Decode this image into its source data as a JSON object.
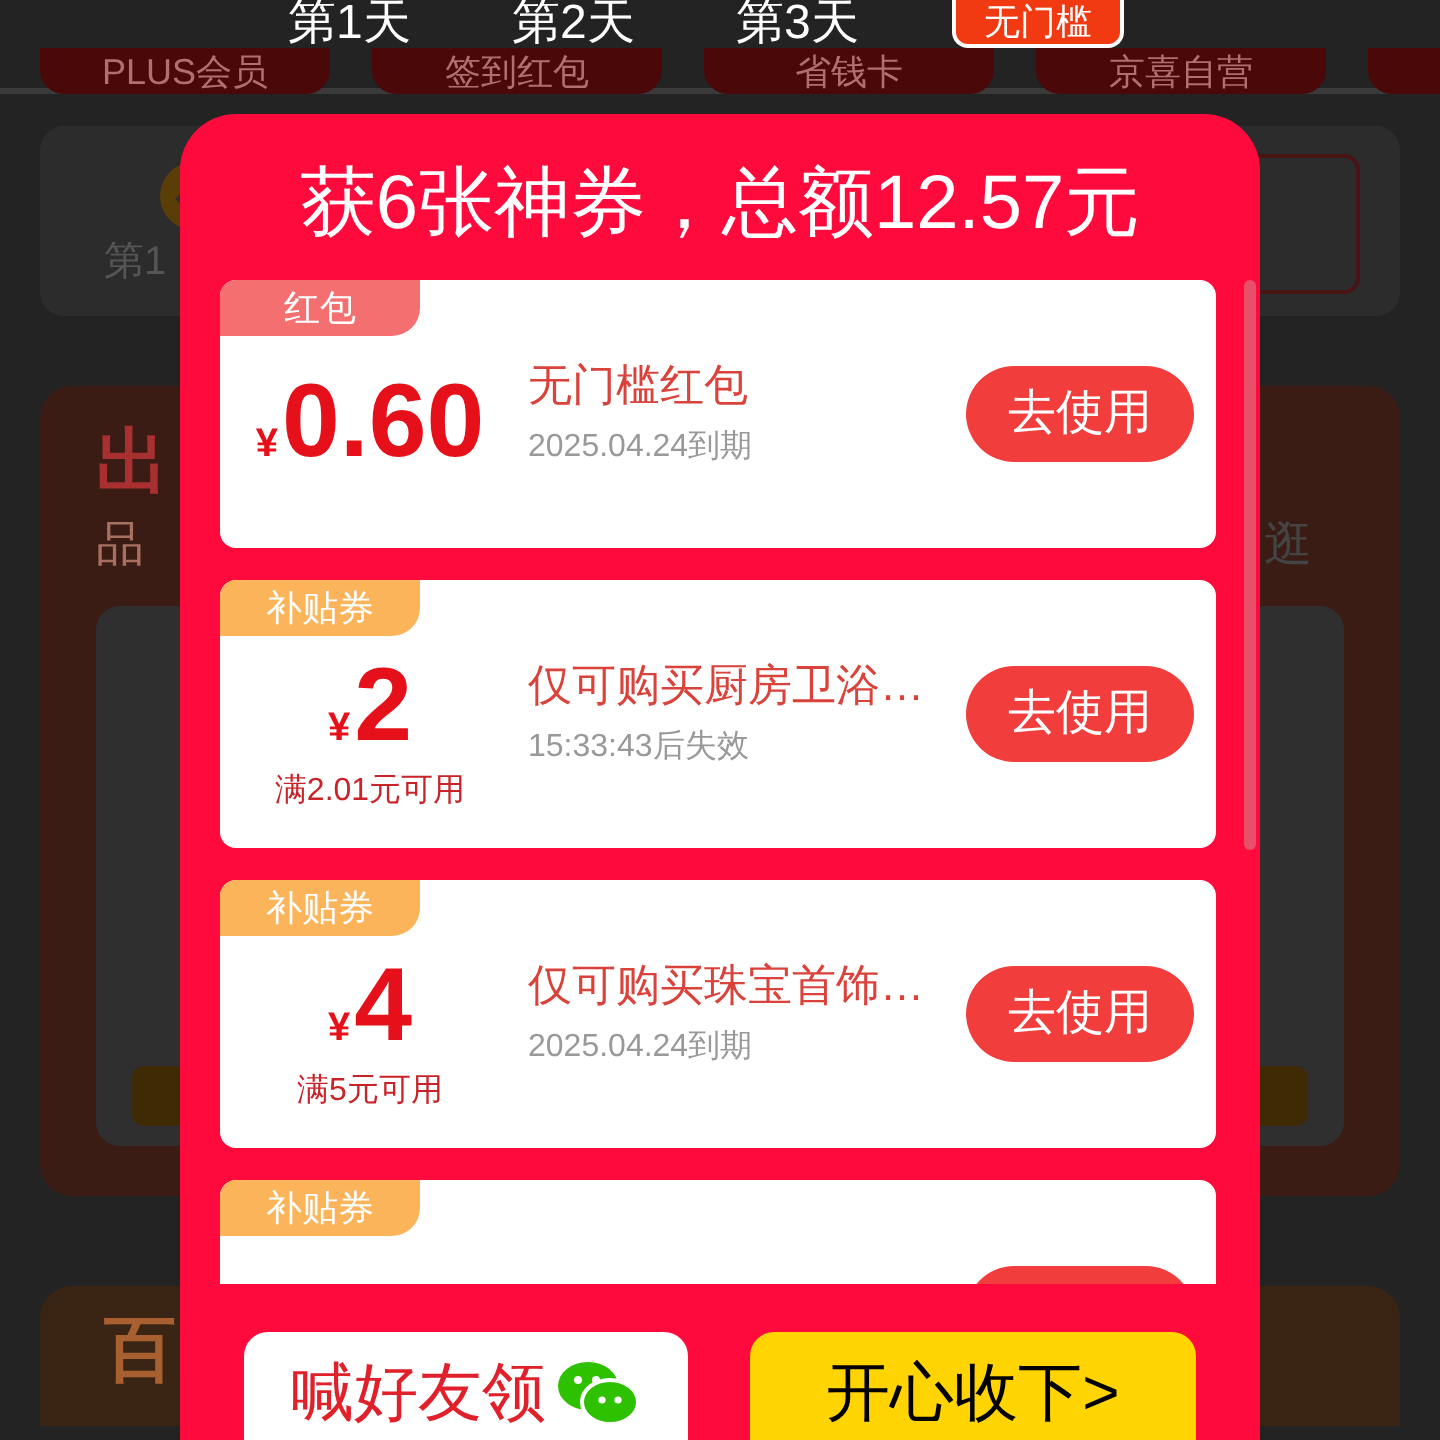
{
  "background": {
    "chips": [
      {
        "label": "PLUS会员"
      },
      {
        "label": "签到红包"
      },
      {
        "label": "省钱卡"
      },
      {
        "label": "京喜自营"
      }
    ],
    "checkin_text": "第1",
    "section_title": "出",
    "section_subtitle": "品",
    "section_link": "逛",
    "lower_title": "百"
  },
  "day_labels": [
    "第1天",
    "第2天",
    "第3天"
  ],
  "badge": "无门槛",
  "dialog": {
    "title": "获6张神券，总额12.57元",
    "coupons": [
      {
        "kind": "red_packet",
        "tag": "红包",
        "currency": "¥",
        "amount": "0.60",
        "name": "无门槛红包",
        "expiry": "2025.04.24到期",
        "button": "去使用"
      },
      {
        "kind": "subsidy",
        "tag": "补贴券",
        "currency": "¥",
        "amount": "2",
        "condition": "满2.01元可用",
        "name": "仅可购买厨房卫浴…",
        "expiry": "15:33:43后失效",
        "button": "去使用"
      },
      {
        "kind": "subsidy",
        "tag": "补贴券",
        "currency": "¥",
        "amount": "4",
        "condition": "满5元可用",
        "name": "仅可购买珠宝首饰…",
        "expiry": "2025.04.24到期",
        "button": "去使用"
      },
      {
        "kind": "subsidy",
        "tag": "补贴券"
      }
    ],
    "share_button": "喊好友领",
    "accept_button": "开心收下>"
  }
}
